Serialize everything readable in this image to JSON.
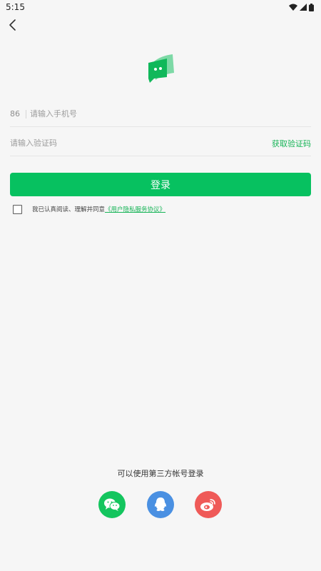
{
  "status_bar": {
    "time": "5:15"
  },
  "phone": {
    "country_code": "86",
    "placeholder": "请输入手机号"
  },
  "code": {
    "placeholder": "请输入验证码",
    "get_code_label": "获取验证码"
  },
  "login_label": "登录",
  "agreement": {
    "text": "我已认真阅读、理解并同意",
    "link": "《用户隐私服务协议》"
  },
  "third_party": {
    "title": "可以使用第三方帐号登录",
    "icons": [
      "wechat-icon",
      "qq-icon",
      "weibo-icon"
    ]
  },
  "colors": {
    "accent": "#07c160",
    "qq": "#4a90e2",
    "weibo": "#ef5a58"
  }
}
